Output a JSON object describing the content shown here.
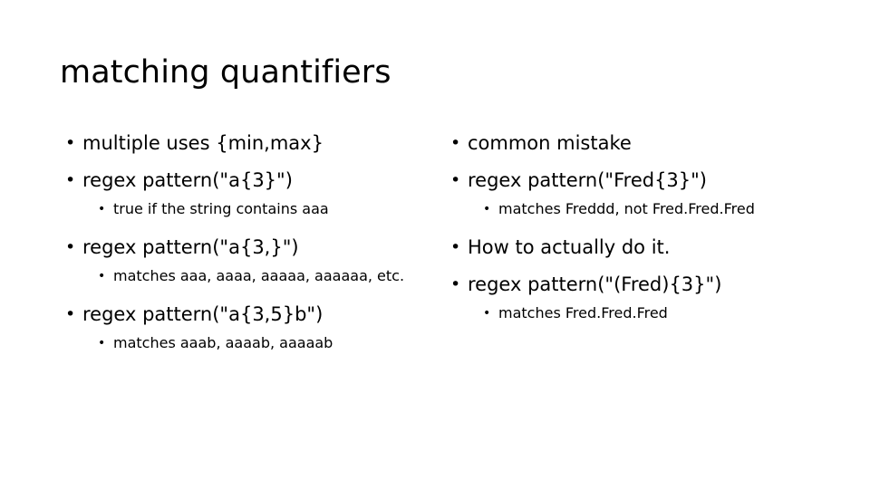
{
  "slide": {
    "title": "matching quantifiers",
    "background_color": "#ffffff",
    "text_color": "#000000",
    "bullet_glyph": "•",
    "left_column": [
      {
        "level": 1,
        "text": "multiple uses {min,max}"
      },
      {
        "level": 1,
        "text": "regex pattern(\"a{3}\")"
      },
      {
        "level": 2,
        "text": "true if the string contains aaa"
      },
      {
        "level": 1,
        "text": "regex pattern(\"a{3,}\")"
      },
      {
        "level": 2,
        "text": "matches aaa, aaaa, aaaaa, aaaaaa, etc."
      },
      {
        "level": 1,
        "text": "regex pattern(\"a{3,5}b\")"
      },
      {
        "level": 2,
        "text": "matches aaab, aaaab, aaaaab"
      }
    ],
    "right_column": [
      {
        "level": 1,
        "text": "common mistake"
      },
      {
        "level": 1,
        "text": "regex pattern(\"Fred{3}\")"
      },
      {
        "level": 2,
        "text": "matches Freddd, not Fred.Fred.Fred"
      },
      {
        "level": 1,
        "text": "How to actually do it."
      },
      {
        "level": 1,
        "text": "regex pattern(\"(Fred){3}\")"
      },
      {
        "level": 2,
        "text": "matches Fred.Fred.Fred"
      }
    ]
  }
}
